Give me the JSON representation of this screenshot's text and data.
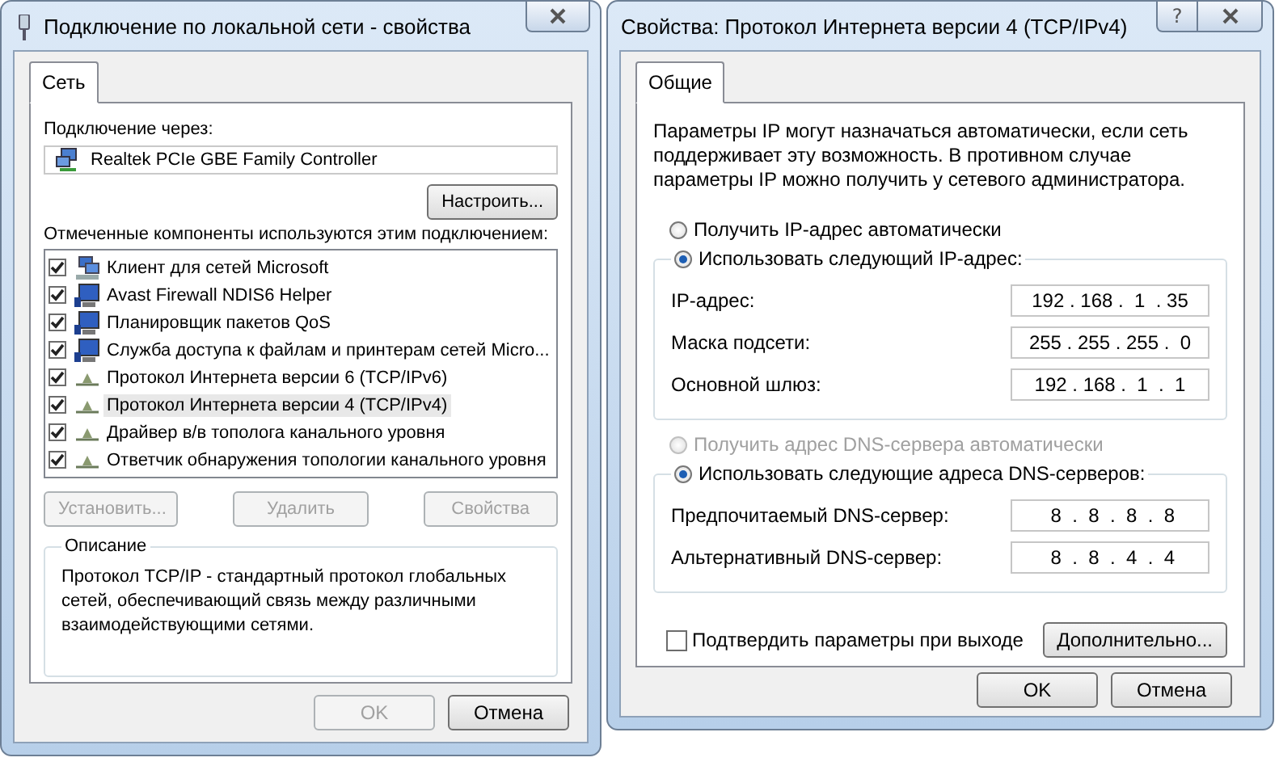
{
  "left_window": {
    "title": "Подключение по локальной сети - свойства",
    "tabs": [
      {
        "label": "Сеть",
        "selected": true
      }
    ],
    "connect_via_label": "Подключение через:",
    "adapter": "Realtek PCIe GBE Family Controller",
    "configure_button": "Настроить...",
    "components_label": "Отмеченные компоненты используются этим подключением:",
    "components": [
      {
        "kind": "client",
        "label": "Клиент для сетей Microsoft",
        "checked": true,
        "selected": false
      },
      {
        "kind": "service",
        "label": "Avast Firewall NDIS6 Helper",
        "checked": true,
        "selected": false
      },
      {
        "kind": "service",
        "label": "Планировщик пакетов QoS",
        "checked": true,
        "selected": false
      },
      {
        "kind": "service",
        "label": "Служба доступа к файлам и принтерам сетей Micro...",
        "checked": true,
        "selected": false
      },
      {
        "kind": "protocol",
        "label": "Протокол Интернета версии 6 (TCP/IPv6)",
        "checked": true,
        "selected": false
      },
      {
        "kind": "protocol",
        "label": "Протокол Интернета версии 4 (TCP/IPv4)",
        "checked": true,
        "selected": true
      },
      {
        "kind": "protocol",
        "label": "Драйвер в/в тополога канального уровня",
        "checked": true,
        "selected": false
      },
      {
        "kind": "protocol",
        "label": "Ответчик обнаружения топологии канального уровня",
        "checked": true,
        "selected": false
      }
    ],
    "action_buttons": [
      {
        "label": "Установить...",
        "disabled": true
      },
      {
        "label": "Удалить",
        "disabled": true
      },
      {
        "label": "Свойства",
        "disabled": true
      }
    ],
    "description": {
      "title": "Описание",
      "text": "Протокол TCP/IP - стандартный протокол глобальных сетей, обеспечивающий связь между различными взаимодействующими сетями."
    },
    "dialog_buttons": [
      {
        "label": "OK",
        "disabled": true
      },
      {
        "label": "Отмена",
        "disabled": false
      }
    ]
  },
  "right_window": {
    "title": "Свойства: Протокол Интернета версии 4 (TCP/IPv4)",
    "help_button": "?",
    "tabs": [
      {
        "label": "Общие",
        "selected": true
      }
    ],
    "intro": "Параметры IP могут назначаться автоматически, если сеть поддерживает эту возможность. В противном случае параметры IP можно получить у сетевого администратора.",
    "ip_mode": [
      {
        "label": "Получить IP-адрес автоматически",
        "selected": false,
        "disabled": false
      },
      {
        "label": "Использовать следующий IP-адрес:",
        "selected": true,
        "disabled": false
      }
    ],
    "ip_fields": [
      {
        "label": "IP-адрес:",
        "value": "192 . 168 .  1  . 35"
      },
      {
        "label": "Маска подсети:",
        "value": "255 . 255 . 255 .  0"
      },
      {
        "label": "Основной шлюз:",
        "value": "192 . 168 .  1  .  1"
      }
    ],
    "dns_mode": [
      {
        "label": "Получить адрес DNS-сервера автоматически",
        "selected": false,
        "disabled": true
      },
      {
        "label": "Использовать следующие адреса DNS-серверов:",
        "selected": true,
        "disabled": false
      }
    ],
    "dns_fields": [
      {
        "label": "Предпочитаемый DNS-сервер:",
        "value": " 8  .  8  .  8  .  8"
      },
      {
        "label": "Альтернативный DNS-сервер:",
        "value": " 8  .  8  .  4  .  4"
      }
    ],
    "validate_checkbox": {
      "label": "Подтвердить параметры при выходе",
      "checked": false
    },
    "advanced_button": "Дополнительно...",
    "dialog_buttons": [
      {
        "label": "OK",
        "disabled": false
      },
      {
        "label": "Отмена",
        "disabled": false
      }
    ]
  }
}
